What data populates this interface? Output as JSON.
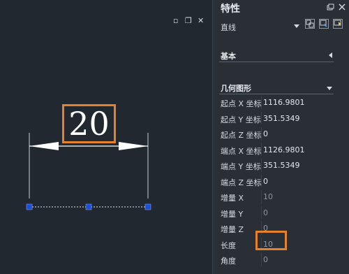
{
  "window_controls": {
    "restore": "▫",
    "maximize": "❐",
    "close": "✕"
  },
  "drawing": {
    "dimension_text": "20"
  },
  "panel": {
    "title": "特性",
    "selection": "直线",
    "sections": {
      "basic": "基本",
      "geometry": "几何图形"
    },
    "properties": [
      {
        "name": "起点 X 坐标",
        "value": "1116.9801",
        "readonly": false
      },
      {
        "name": "起点 Y 坐标",
        "value": "351.5349",
        "readonly": false
      },
      {
        "name": "起点 Z 坐标",
        "value": "0",
        "readonly": false
      },
      {
        "name": "端点 X 坐标",
        "value": "1126.9801",
        "readonly": false
      },
      {
        "name": "端点 Y 坐标",
        "value": "351.5349",
        "readonly": false
      },
      {
        "name": "端点 Z 坐标",
        "value": "0",
        "readonly": false
      },
      {
        "name": "增量 X",
        "value": "10",
        "readonly": true
      },
      {
        "name": "增量 Y",
        "value": "0",
        "readonly": true
      },
      {
        "name": "增量 Z",
        "value": "0",
        "readonly": true
      },
      {
        "name": "长度",
        "value": "10",
        "readonly": true
      },
      {
        "name": "角度",
        "value": "0",
        "readonly": true
      }
    ]
  },
  "colors": {
    "background": "#212830",
    "panel": "#2a2f36",
    "highlight": "#e5812a",
    "grip": "#1f4fd6"
  }
}
